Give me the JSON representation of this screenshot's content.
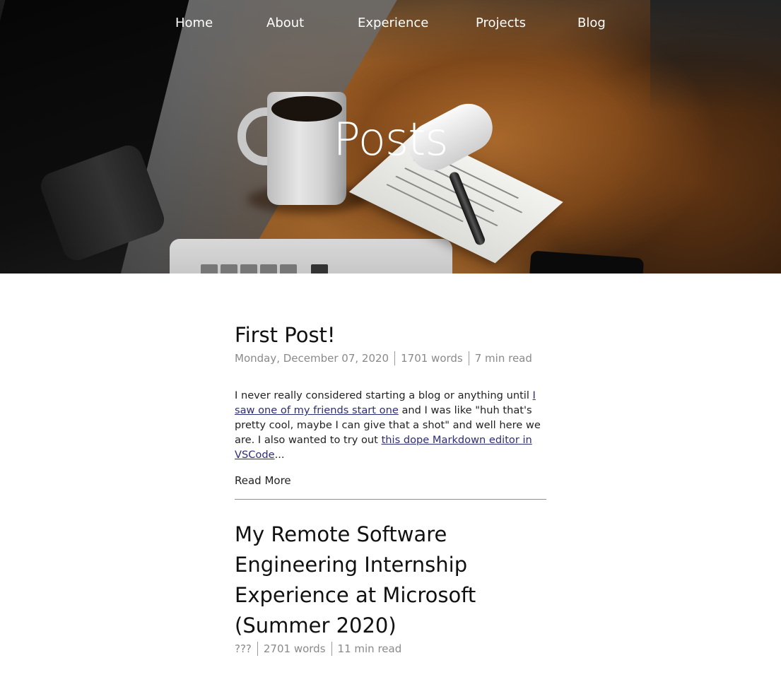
{
  "nav": {
    "items": [
      {
        "label": "Home"
      },
      {
        "label": "About"
      },
      {
        "label": "Experience"
      },
      {
        "label": "Projects"
      },
      {
        "label": "Blog"
      }
    ]
  },
  "hero": {
    "title": "Posts"
  },
  "posts": [
    {
      "title": "First Post!",
      "date": "Monday, December 07, 2020",
      "words": "1701 words",
      "read_time": "7 min read",
      "excerpt": {
        "text_1": "I never really considered starting a blog or anything until ",
        "link_1": "I saw one of my friends start one",
        "text_2": " and I was like \"huh that's pretty cool, maybe I can give that a shot\" and well here we are. I also wanted to try out ",
        "link_2": "this dope Markdown editor in VSCode",
        "text_3": "..."
      },
      "read_more": "Read More"
    },
    {
      "title": "My Remote Software Engineering Internship Experience at Microsoft (Summer 2020)",
      "date": "???",
      "words": "2701 words",
      "read_time": "11 min read"
    }
  ]
}
